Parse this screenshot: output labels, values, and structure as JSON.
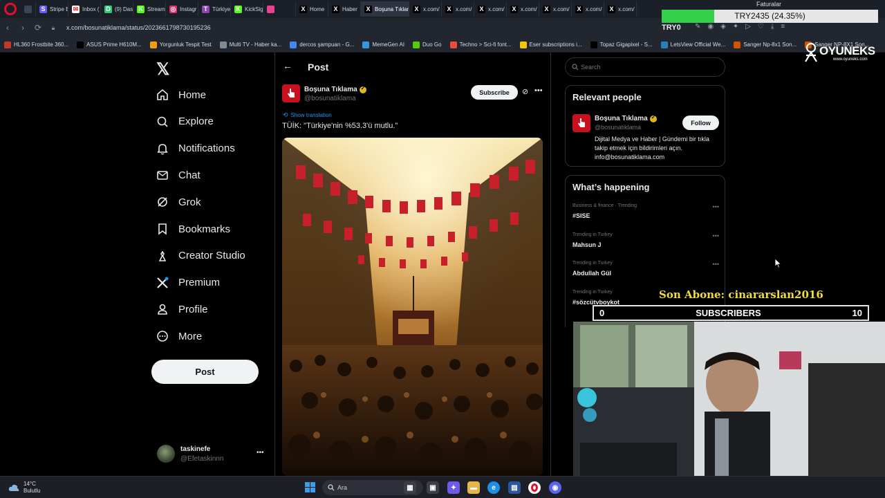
{
  "browser": {
    "tabs": [
      {
        "label": "",
        "color": "#3a4556",
        "glyph": ""
      },
      {
        "label": "Stripe E",
        "color": "#635bff",
        "glyph": "S"
      },
      {
        "label": "Inbox (",
        "color": "#ffffff",
        "glyph": "✉"
      },
      {
        "label": "(9) Das",
        "color": "#2ecc71",
        "glyph": "D"
      },
      {
        "label": "Stream",
        "color": "#53fc18",
        "glyph": "K"
      },
      {
        "label": "Instagr",
        "color": "#e1306c",
        "glyph": "◎"
      },
      {
        "label": "Türkiye",
        "color": "#8e44ad",
        "glyph": "T"
      },
      {
        "label": "KickSig",
        "color": "#53fc18",
        "glyph": "K"
      },
      {
        "label": "",
        "color": "#e84393",
        "glyph": ""
      },
      {
        "label": "Home",
        "color": "#000000",
        "glyph": "X"
      },
      {
        "label": "Haber",
        "color": "#000000",
        "glyph": "X"
      },
      {
        "label": "Boşuna Tıklam",
        "color": "#000000",
        "glyph": "X",
        "active": true
      },
      {
        "label": "x.com/",
        "color": "#000000",
        "glyph": "X"
      },
      {
        "label": "x.com/",
        "color": "#000000",
        "glyph": "X"
      },
      {
        "label": "x.com/",
        "color": "#000000",
        "glyph": "X"
      },
      {
        "label": "x.com/",
        "color": "#000000",
        "glyph": "X"
      },
      {
        "label": "x.com/",
        "color": "#000000",
        "glyph": "X"
      },
      {
        "label": "x.com/",
        "color": "#000000",
        "glyph": "X"
      },
      {
        "label": "x.com/",
        "color": "#000000",
        "glyph": "X"
      }
    ],
    "url": "x.com/bosunatiklama/status/2023661798730195236",
    "bookmarks": [
      {
        "label": "HL360 Frostbite 360...",
        "color": "#c0392b"
      },
      {
        "label": "ASUS Prime H610M...",
        "color": "#000000"
      },
      {
        "label": "Yorgunluk Tespit Test",
        "color": "#f39c12"
      },
      {
        "label": "Multi TV - Haber ka...",
        "color": "#7f8c8d"
      },
      {
        "label": "dercos şampuan - G...",
        "color": "#4285f4"
      },
      {
        "label": "MemeGen AI",
        "color": "#3498db"
      },
      {
        "label": "Duo Go",
        "color": "#58cc02"
      },
      {
        "label": "Techno > Sci-fi font...",
        "color": "#e74c3c"
      },
      {
        "label": "Eser subscriptions i...",
        "color": "#f1c40f"
      },
      {
        "label": "Topaz Gigapixel - S...",
        "color": "#000000"
      },
      {
        "label": "LetsView Official We...",
        "color": "#2980b9"
      },
      {
        "label": "Sanger Np-8x1 Son...",
        "color": "#d35400"
      },
      {
        "label": "Sanger NP-8X1 Son...",
        "color": "#d35400"
      }
    ]
  },
  "sidebar": {
    "items": [
      {
        "label": "Home",
        "icon": "home-icon"
      },
      {
        "label": "Explore",
        "icon": "search-icon"
      },
      {
        "label": "Notifications",
        "icon": "bell-icon"
      },
      {
        "label": "Chat",
        "icon": "mail-icon"
      },
      {
        "label": "Grok",
        "icon": "grok-icon"
      },
      {
        "label": "Bookmarks",
        "icon": "bookmark-icon"
      },
      {
        "label": "Creator Studio",
        "icon": "creator-icon"
      },
      {
        "label": "Premium",
        "icon": "x-premium-icon"
      },
      {
        "label": "Profile",
        "icon": "person-icon"
      },
      {
        "label": "More",
        "icon": "more-circle-icon"
      }
    ],
    "post_button": "Post",
    "account": {
      "name": "taskinefe",
      "handle": "@Efetaskinnn"
    }
  },
  "post": {
    "header_title": "Post",
    "author_name": "Boşuna Tıklama",
    "author_handle": "@bosunatiklama",
    "subscribe_label": "Subscribe",
    "show_translation": "Show translation",
    "text": "TÜİK: \"Türkiye'nin %53.3'ü mutlu.\""
  },
  "right": {
    "search_placeholder": "Search",
    "relevant_title": "Relevant people",
    "relevant": {
      "name": "Boşuna Tıklama",
      "handle": "@bosunatiklama",
      "follow_label": "Follow",
      "bio": "Dijital Medya ve Haber | Gündemi bir tıkla takip etmek için bildirimleri açın. info@bosunatiklama.com"
    },
    "happening_title": "What’s happening",
    "trends": [
      {
        "meta": "Business & finance · Trending",
        "name": "#SISE"
      },
      {
        "meta": "Trending in Turkey",
        "name": "Mahsun J"
      },
      {
        "meta": "Trending in Turkey",
        "name": "Abdullah Gül"
      },
      {
        "meta": "Trending in Turkey",
        "name": "#sözcütvboykot"
      }
    ]
  },
  "overlay": {
    "goal_label": "TRY2435 (24.35%)",
    "goal_fraction": 0.2435,
    "faturalar": "Faturalar",
    "try_text": "TRY0",
    "sponsor_name": "OYUNEKS",
    "sponsor_url": "www.oyuneks.com",
    "last_sub": "Son Abone: cinararslan2016",
    "subs_min": "0",
    "subs_label": "SUBSCRIBERS",
    "subs_max": "10"
  },
  "taskbar": {
    "temperature": "14°C",
    "weather": "Bulutlu",
    "search_label": "Ara"
  },
  "colors": {
    "accent_blue": "#1d9bf0",
    "brand_red": "#c8101e",
    "verified_gold": "#e2b719",
    "goal_green": "#35d04a",
    "overlay_yellow": "#f2dc3c"
  }
}
